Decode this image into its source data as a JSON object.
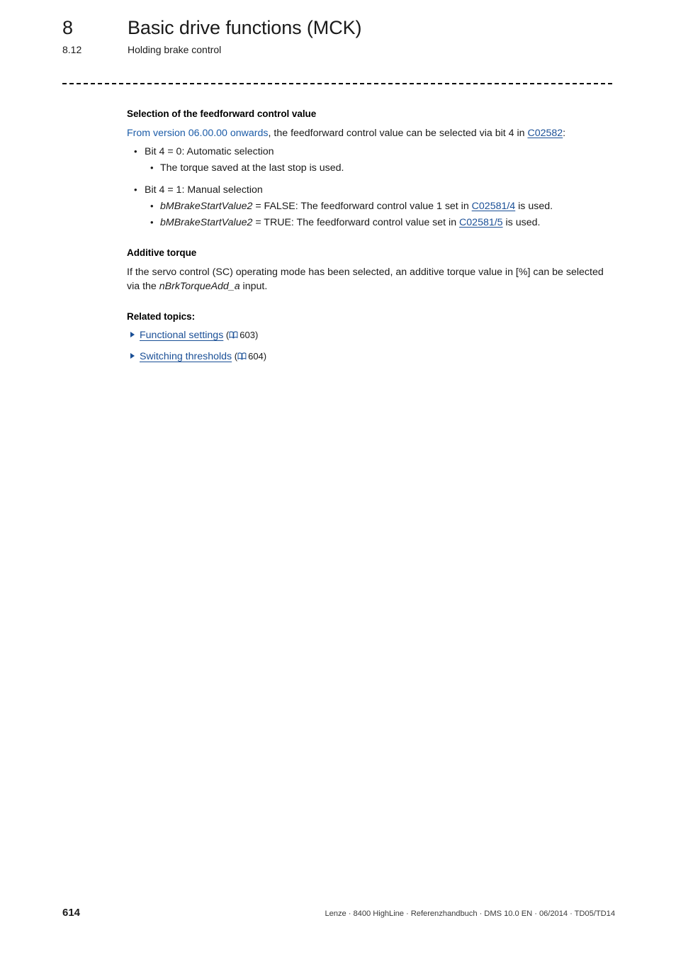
{
  "header": {
    "chapter_number": "8",
    "chapter_title": "Basic drive functions (MCK)",
    "section_number": "8.12",
    "section_title": "Holding brake control"
  },
  "content": {
    "feedforward": {
      "heading": "Selection of the feedforward control value",
      "intro_version": "From version 06.00.00 onwards",
      "intro_rest": ", the feedforward control value can be selected via bit 4 in ",
      "intro_link": "C02582",
      "intro_end": ":",
      "bullets": [
        {
          "label": "Bit 4 = 0: Automatic selection",
          "sub": [
            {
              "text": "The torque saved at the last stop is used."
            }
          ]
        },
        {
          "label": "Bit 4 = 1: Manual selection",
          "sub": [
            {
              "var": "bMBrakeStartValue2",
              "mid": " = FALSE: The feedforward control value 1 set in ",
              "link": "C02581/4",
              "end": " is used."
            },
            {
              "var": "bMBrakeStartValue2",
              "mid": " = TRUE: The feedforward control value set in ",
              "link": "C02581/5",
              "end": " is used."
            }
          ]
        }
      ]
    },
    "additive_torque": {
      "heading": "Additive torque",
      "text_start": "If the servo control (SC) operating mode has been selected, an additive torque value in [%] can be selected via the ",
      "variable": "nBrkTorqueAdd_a",
      "text_end": " input."
    },
    "related_topics": {
      "heading": "Related topics:",
      "items": [
        {
          "label": "Functional settings",
          "ref_open": "(",
          "page": "603",
          "ref_close": ")"
        },
        {
          "label": "Switching thresholds",
          "ref_open": "(",
          "page": "604",
          "ref_close": ")"
        }
      ]
    }
  },
  "footer": {
    "page_number": "614",
    "meta": "Lenze · 8400 HighLine · Referenzhandbuch · DMS 10.0 EN · 06/2014 · TD05/TD14"
  },
  "icons": {
    "triangle": "triangle-right-icon",
    "book": "book-icon"
  },
  "colors": {
    "link": "#1a4f96",
    "version_text": "#1c5ca8",
    "body_text": "#1a1a1a"
  }
}
